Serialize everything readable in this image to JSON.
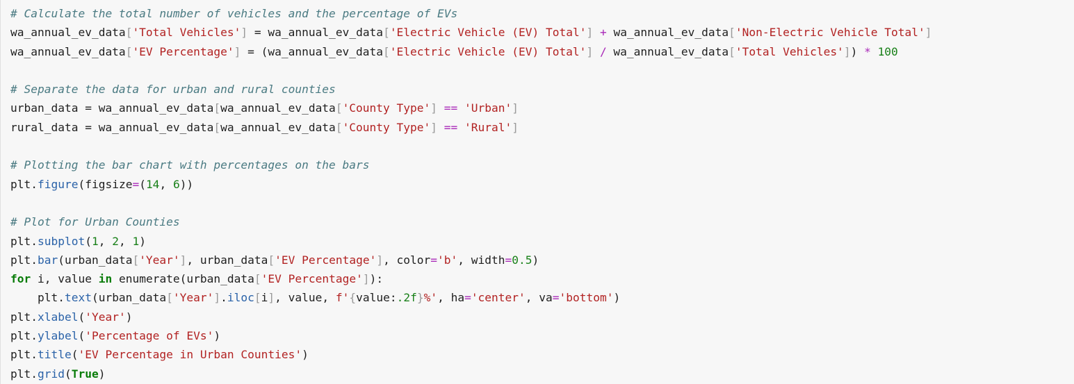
{
  "editor": {
    "lines": [
      [
        {
          "t": "# Calculate the total number of vehicles and the percentage of EVs",
          "k": "comment"
        }
      ],
      [
        {
          "t": "wa_annual_ev_data",
          "k": "name"
        },
        {
          "t": "[",
          "k": "bracket"
        },
        {
          "t": "'Total Vehicles'",
          "k": "string"
        },
        {
          "t": "]",
          "k": "bracket"
        },
        {
          "t": " = ",
          "k": "name"
        },
        {
          "t": "wa_annual_ev_data",
          "k": "name"
        },
        {
          "t": "[",
          "k": "bracket"
        },
        {
          "t": "'Electric Vehicle (EV) Total'",
          "k": "string"
        },
        {
          "t": "]",
          "k": "bracket"
        },
        {
          "t": " ",
          "k": "name"
        },
        {
          "t": "+",
          "k": "operator"
        },
        {
          "t": " wa_annual_ev_data",
          "k": "name"
        },
        {
          "t": "[",
          "k": "bracket"
        },
        {
          "t": "'Non-Electric Vehicle Total'",
          "k": "string"
        },
        {
          "t": "]",
          "k": "bracket"
        }
      ],
      [
        {
          "t": "wa_annual_ev_data",
          "k": "name"
        },
        {
          "t": "[",
          "k": "bracket"
        },
        {
          "t": "'EV Percentage'",
          "k": "string"
        },
        {
          "t": "]",
          "k": "bracket"
        },
        {
          "t": " = (",
          "k": "name"
        },
        {
          "t": "wa_annual_ev_data",
          "k": "name"
        },
        {
          "t": "[",
          "k": "bracket"
        },
        {
          "t": "'Electric Vehicle (EV) Total'",
          "k": "string"
        },
        {
          "t": "]",
          "k": "bracket"
        },
        {
          "t": " ",
          "k": "name"
        },
        {
          "t": "/",
          "k": "operator"
        },
        {
          "t": " wa_annual_ev_data",
          "k": "name"
        },
        {
          "t": "[",
          "k": "bracket"
        },
        {
          "t": "'Total Vehicles'",
          "k": "string"
        },
        {
          "t": "]",
          "k": "bracket"
        },
        {
          "t": ") ",
          "k": "name"
        },
        {
          "t": "*",
          "k": "operator"
        },
        {
          "t": " ",
          "k": "name"
        },
        {
          "t": "100",
          "k": "number"
        }
      ],
      [],
      [
        {
          "t": "# Separate the data for urban and rural counties",
          "k": "comment"
        }
      ],
      [
        {
          "t": "urban_data = wa_annual_ev_data",
          "k": "name"
        },
        {
          "t": "[",
          "k": "bracket"
        },
        {
          "t": "wa_annual_ev_data",
          "k": "name"
        },
        {
          "t": "[",
          "k": "bracket"
        },
        {
          "t": "'County Type'",
          "k": "string"
        },
        {
          "t": "]",
          "k": "bracket"
        },
        {
          "t": " ",
          "k": "name"
        },
        {
          "t": "==",
          "k": "operator"
        },
        {
          "t": " ",
          "k": "name"
        },
        {
          "t": "'Urban'",
          "k": "string"
        },
        {
          "t": "]",
          "k": "bracket"
        }
      ],
      [
        {
          "t": "rural_data = wa_annual_ev_data",
          "k": "name"
        },
        {
          "t": "[",
          "k": "bracket"
        },
        {
          "t": "wa_annual_ev_data",
          "k": "name"
        },
        {
          "t": "[",
          "k": "bracket"
        },
        {
          "t": "'County Type'",
          "k": "string"
        },
        {
          "t": "]",
          "k": "bracket"
        },
        {
          "t": " ",
          "k": "name"
        },
        {
          "t": "==",
          "k": "operator"
        },
        {
          "t": " ",
          "k": "name"
        },
        {
          "t": "'Rural'",
          "k": "string"
        },
        {
          "t": "]",
          "k": "bracket"
        }
      ],
      [],
      [
        {
          "t": "# Plotting the bar chart with percentages on the bars",
          "k": "comment"
        }
      ],
      [
        {
          "t": "plt.",
          "k": "name"
        },
        {
          "t": "figure",
          "k": "func"
        },
        {
          "t": "(figsize",
          "k": "name"
        },
        {
          "t": "=",
          "k": "operator"
        },
        {
          "t": "(",
          "k": "name"
        },
        {
          "t": "14",
          "k": "number"
        },
        {
          "t": ", ",
          "k": "name"
        },
        {
          "t": "6",
          "k": "number"
        },
        {
          "t": "))",
          "k": "name"
        }
      ],
      [],
      [
        {
          "t": "# Plot for Urban Counties",
          "k": "comment"
        }
      ],
      [
        {
          "t": "plt.",
          "k": "name"
        },
        {
          "t": "subplot",
          "k": "func"
        },
        {
          "t": "(",
          "k": "name"
        },
        {
          "t": "1",
          "k": "number"
        },
        {
          "t": ", ",
          "k": "name"
        },
        {
          "t": "2",
          "k": "number"
        },
        {
          "t": ", ",
          "k": "name"
        },
        {
          "t": "1",
          "k": "number"
        },
        {
          "t": ")",
          "k": "name"
        }
      ],
      [
        {
          "t": "plt.",
          "k": "name"
        },
        {
          "t": "bar",
          "k": "func"
        },
        {
          "t": "(urban_data",
          "k": "name"
        },
        {
          "t": "[",
          "k": "bracket"
        },
        {
          "t": "'Year'",
          "k": "string"
        },
        {
          "t": "]",
          "k": "bracket"
        },
        {
          "t": ", urban_data",
          "k": "name"
        },
        {
          "t": "[",
          "k": "bracket"
        },
        {
          "t": "'EV Percentage'",
          "k": "string"
        },
        {
          "t": "]",
          "k": "bracket"
        },
        {
          "t": ", color",
          "k": "name"
        },
        {
          "t": "=",
          "k": "operator"
        },
        {
          "t": "'b'",
          "k": "string"
        },
        {
          "t": ", width",
          "k": "name"
        },
        {
          "t": "=",
          "k": "operator"
        },
        {
          "t": "0.5",
          "k": "number"
        },
        {
          "t": ")",
          "k": "name"
        }
      ],
      [
        {
          "t": "for",
          "k": "keyword"
        },
        {
          "t": " i, value ",
          "k": "name"
        },
        {
          "t": "in",
          "k": "keyword"
        },
        {
          "t": " enumerate(urban_data",
          "k": "name"
        },
        {
          "t": "[",
          "k": "bracket"
        },
        {
          "t": "'EV Percentage'",
          "k": "string"
        },
        {
          "t": "]",
          "k": "bracket"
        },
        {
          "t": "):",
          "k": "name"
        }
      ],
      [
        {
          "t": "    plt.",
          "k": "name"
        },
        {
          "t": "text",
          "k": "func"
        },
        {
          "t": "(urban_data",
          "k": "name"
        },
        {
          "t": "[",
          "k": "bracket"
        },
        {
          "t": "'Year'",
          "k": "string"
        },
        {
          "t": "]",
          "k": "bracket"
        },
        {
          "t": ".",
          "k": "name"
        },
        {
          "t": "iloc",
          "k": "func"
        },
        {
          "t": "[",
          "k": "bracket"
        },
        {
          "t": "i",
          "k": "name"
        },
        {
          "t": "]",
          "k": "bracket"
        },
        {
          "t": ", value, ",
          "k": "name"
        },
        {
          "t": "f'",
          "k": "string"
        },
        {
          "t": "{",
          "k": "bracket"
        },
        {
          "t": "value:",
          "k": "name"
        },
        {
          "t": ".2f",
          "k": "number"
        },
        {
          "t": "}",
          "k": "bracket"
        },
        {
          "t": "%'",
          "k": "string"
        },
        {
          "t": ", ha",
          "k": "name"
        },
        {
          "t": "=",
          "k": "operator"
        },
        {
          "t": "'center'",
          "k": "string"
        },
        {
          "t": ", va",
          "k": "name"
        },
        {
          "t": "=",
          "k": "operator"
        },
        {
          "t": "'bottom'",
          "k": "string"
        },
        {
          "t": ")",
          "k": "name"
        }
      ],
      [
        {
          "t": "plt.",
          "k": "name"
        },
        {
          "t": "xlabel",
          "k": "func"
        },
        {
          "t": "(",
          "k": "name"
        },
        {
          "t": "'Year'",
          "k": "string"
        },
        {
          "t": ")",
          "k": "name"
        }
      ],
      [
        {
          "t": "plt.",
          "k": "name"
        },
        {
          "t": "ylabel",
          "k": "func"
        },
        {
          "t": "(",
          "k": "name"
        },
        {
          "t": "'Percentage of EVs'",
          "k": "string"
        },
        {
          "t": ")",
          "k": "name"
        }
      ],
      [
        {
          "t": "plt.",
          "k": "name"
        },
        {
          "t": "title",
          "k": "func"
        },
        {
          "t": "(",
          "k": "name"
        },
        {
          "t": "'EV Percentage in Urban Counties'",
          "k": "string"
        },
        {
          "t": ")",
          "k": "name"
        }
      ],
      [
        {
          "t": "plt.",
          "k": "name"
        },
        {
          "t": "grid",
          "k": "func"
        },
        {
          "t": "(",
          "k": "name"
        },
        {
          "t": "True",
          "k": "keyword"
        },
        {
          "t": ")",
          "k": "name"
        }
      ]
    ]
  },
  "colors": {
    "cell_background": "#f7f7f7",
    "comment": "#4a7a82",
    "string": "#b22222",
    "number": "#198019",
    "keyword": "#087c08",
    "operator": "#a929b8",
    "function": "#2a62a8"
  }
}
